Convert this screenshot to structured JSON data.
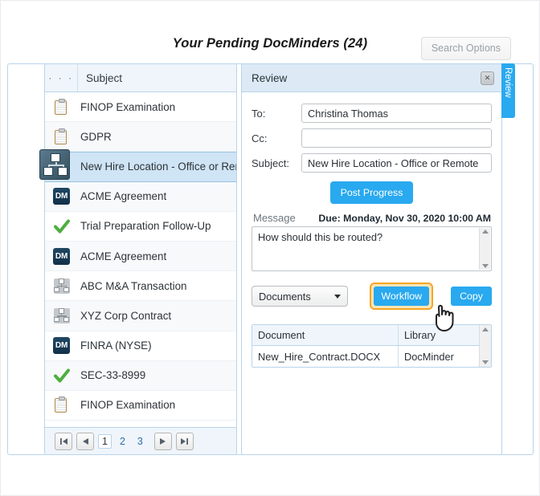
{
  "header": {
    "title": "Your Pending DocMinders (24)",
    "search_options_label": "Search Options"
  },
  "list": {
    "columns": {
      "icon_header": "· · ·",
      "subject_header": "Subject"
    },
    "rows": [
      {
        "icon": "clipboard-icon",
        "label": "FINOP Examination"
      },
      {
        "icon": "clipboard-icon",
        "label": "GDPR"
      },
      {
        "icon": "workflow-icon",
        "label": "New Hire Location - Office or Remote"
      },
      {
        "icon": "dm-icon",
        "label": "ACME Agreement"
      },
      {
        "icon": "check-icon",
        "label": "Trial Preparation Follow-Up"
      },
      {
        "icon": "dm-icon",
        "label": "ACME Agreement"
      },
      {
        "icon": "workflow-icon",
        "label": "ABC M&A Transaction"
      },
      {
        "icon": "workflow-icon",
        "label": "XYZ Corp Contract"
      },
      {
        "icon": "dm-icon",
        "label": "FINRA (NYSE)"
      },
      {
        "icon": "check-icon",
        "label": "SEC-33-8999"
      },
      {
        "icon": "clipboard-icon",
        "label": "FINOP Examination"
      }
    ],
    "selected_index": 2,
    "pager": {
      "first_label": "|◀",
      "prev_label": "◀",
      "pages": [
        "1",
        "2",
        "3"
      ],
      "current_page": "1",
      "next_label": "▶",
      "last_label": "▶|"
    }
  },
  "review": {
    "title": "Review",
    "close_label": "✕",
    "fields": {
      "to_label": "To:",
      "to_value": "Christina Thomas",
      "cc_label": "Cc:",
      "cc_value": "",
      "cc_placeholder": "",
      "subject_label": "Subject:",
      "subject_value": "New Hire Location - Office or Remote"
    },
    "post_progress_label": "Post Progress",
    "message_label": "Message",
    "due_label": "Due: Monday, Nov 30, 2020 10:00 AM",
    "message_value": "How should this be routed?",
    "controls": {
      "select_value": "Documents",
      "workflow_label": "Workflow",
      "copy_label": "Copy"
    },
    "documents_table": {
      "columns": [
        "Document",
        "Library"
      ],
      "rows": [
        {
          "document": "New_Hire_Contract.DOCX",
          "library": "DocMinder"
        }
      ]
    }
  },
  "side_tab": {
    "label": "Review"
  },
  "colors": {
    "accent_blue": "#29a9ef",
    "panel_border": "#b9d4ea",
    "header_bg": "#ddeaf6",
    "selected_row": "#cfe4f5",
    "highlight_ring": "#f5a623",
    "dm_icon": "#1f4763",
    "check_green": "#4caf3e"
  }
}
